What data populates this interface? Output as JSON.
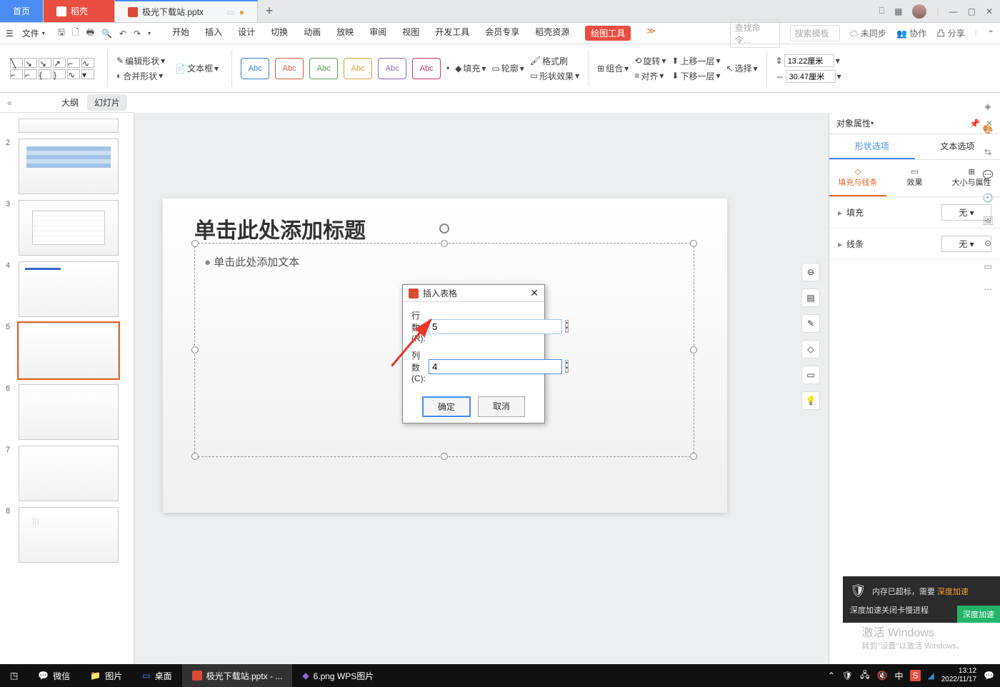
{
  "tabs": {
    "home": "首页",
    "docer": "稻壳",
    "doc_name": "极光下载站.pptx",
    "add": "+"
  },
  "file_menu": "文件",
  "ribbon_menus": [
    "开始",
    "插入",
    "设计",
    "切换",
    "动画",
    "放映",
    "审阅",
    "视图",
    "开发工具",
    "会员专享",
    "稻壳资源",
    "绘图工具"
  ],
  "search_cmd_ph": "查找命令...",
  "search_tpl_ph": "搜索模板",
  "cloud_label": "未同步",
  "coop_label": "协作",
  "share_label": "分享",
  "ribbon": {
    "edit_shape": "编辑形状",
    "merge_shape": "合并形状",
    "text_box": "文本框",
    "abc": "Abc",
    "fill": "填充",
    "outline": "轮廓",
    "effect": "形状效果",
    "format_painter": "格式刷",
    "group": "组合",
    "rotate": "旋转",
    "align": "对齐",
    "bring_forward": "上移一层",
    "send_backward": "下移一层",
    "select": "选择",
    "height": "13.22厘米",
    "width": "30.47厘米"
  },
  "panel": {
    "outline": "大纲",
    "slides": "幻灯片",
    "nums": [
      "",
      "2",
      "3",
      "4",
      "5",
      "6",
      "7",
      "8"
    ]
  },
  "placeholders": {
    "title": "单击此处添加标题",
    "text": "单击此处添加文本"
  },
  "dialog": {
    "title": "插入表格",
    "rows_label": "行数(R):",
    "rows_value": "5",
    "cols_label": "列数(C):",
    "cols_value": "4",
    "ok": "确定",
    "cancel": "取消"
  },
  "right_pane": {
    "header": "对象属性",
    "tab1": "形状选项",
    "tab2": "文本选项",
    "sub1": "填充与线条",
    "sub2": "效果",
    "sub3": "大小与属性",
    "fill_label": "填充",
    "line_label": "线条",
    "none": "无"
  },
  "notif": {
    "line1a": "内存已超标，需要 ",
    "line1b": "深度加速",
    "line2": "深度加速关闭卡慢进程",
    "btn": "深度加速"
  },
  "activate": {
    "l1": "激活 Windows",
    "l2": "转到\"设置\"以激活 Windows。"
  },
  "taskbar": {
    "wechat": "微信",
    "pics": "图片",
    "desktop": "桌面",
    "wps": "极光下载站.pptx - ...",
    "wpspic": "6.png   WPS图片",
    "time": "13:12",
    "date": "2022/11/17"
  }
}
